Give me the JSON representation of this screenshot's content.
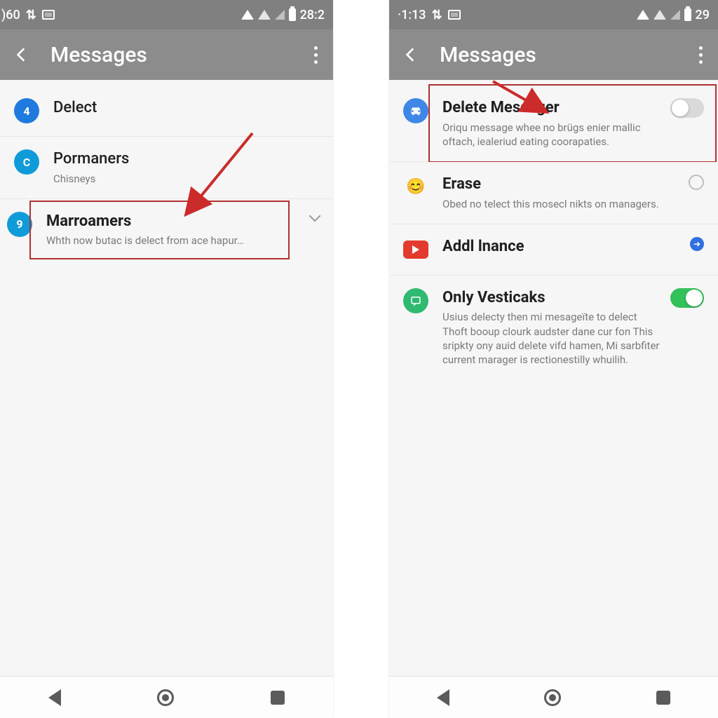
{
  "left": {
    "status": {
      "time": ")60",
      "batt": "28:2"
    },
    "title": "Messages",
    "items": [
      {
        "icon_text": "4",
        "title": "Delect",
        "sub": ""
      },
      {
        "icon_text": "C",
        "title": "Pormaners",
        "sub": "Chisneys"
      },
      {
        "icon_text": "9",
        "title": "Marroamers",
        "sub": "Whth now butac is delect from ace hapur…"
      }
    ]
  },
  "right": {
    "status": {
      "time": "·1:13",
      "batt": "29"
    },
    "title": "Messages",
    "items": [
      {
        "title": "Delete Messager",
        "sub": "Oriqu message whee no brügs enier mallic oftach, iealeriud eating coorapaties."
      },
      {
        "title": "Erase",
        "sub": "Obed no telect this mosecl nikts on managers."
      },
      {
        "title": "Addl lnance",
        "sub": ""
      },
      {
        "title": "Only Vesticaks",
        "sub": "Usius delecty then mi mesageïte to delect Thoft booup clourk audster dane cur fon This sripkty ony auid delete vifd hamen, Mi sarbfiter current marager is rectionestilly whuilih."
      }
    ]
  }
}
